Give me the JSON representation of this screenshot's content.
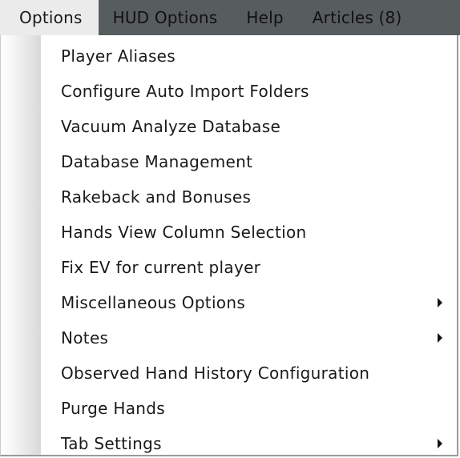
{
  "menubar": {
    "items": [
      {
        "label": "Options",
        "active": true
      },
      {
        "label": "HUD Options"
      },
      {
        "label": "Help"
      },
      {
        "label": "Articles (8)"
      }
    ]
  },
  "dropdown": {
    "items": [
      {
        "label": "Player Aliases",
        "submenu": false
      },
      {
        "label": "Configure Auto Import Folders",
        "submenu": false
      },
      {
        "label": "Vacuum Analyze Database",
        "submenu": false
      },
      {
        "label": "Database Management",
        "submenu": false
      },
      {
        "label": "Rakeback and Bonuses",
        "submenu": false
      },
      {
        "label": "Hands View Column Selection",
        "submenu": false
      },
      {
        "label": "Fix EV for current player",
        "submenu": false
      },
      {
        "label": "Miscellaneous Options",
        "submenu": true
      },
      {
        "label": "Notes",
        "submenu": true
      },
      {
        "label": "Observed Hand History Configuration",
        "submenu": false
      },
      {
        "label": "Purge Hands",
        "submenu": false
      },
      {
        "label": "Tab Settings",
        "submenu": true
      }
    ]
  },
  "icons": {
    "submenu_arrow": "submenu-arrow-icon"
  },
  "colors": {
    "menubar_bg": "#575c5f",
    "active_menu_bg": "#ebebeb",
    "dropdown_bg": "#ffffff",
    "text": "#1a1a1a"
  }
}
